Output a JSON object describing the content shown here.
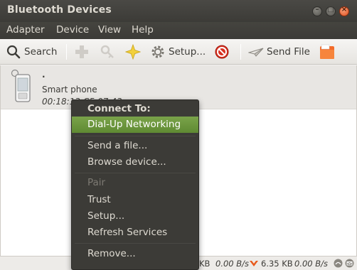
{
  "window": {
    "title": "Bluetooth Devices"
  },
  "menubar": {
    "items": [
      "Adapter",
      "Device",
      "View",
      "Help"
    ]
  },
  "toolbar": {
    "search_label": "Search",
    "setup_label": "Setup...",
    "send_file_label": "Send File"
  },
  "device": {
    "name": ".",
    "type": "Smart phone",
    "address": "00:18:13:C5:07:43"
  },
  "context_menu": {
    "header": "Connect To:",
    "items": [
      "Dial-Up Networking",
      "Send a file...",
      "Browse device...",
      "Pair",
      "Trust",
      "Setup...",
      "Refresh Services",
      "Remove..."
    ]
  },
  "statusbar": {
    "upload_size": "KB",
    "upload_rate": "0.00 B/s",
    "download_size": "6.35 KB",
    "download_rate": "0.00 B/s"
  },
  "colors": {
    "highlight": "#6f9a3e",
    "close": "#e0501f"
  }
}
